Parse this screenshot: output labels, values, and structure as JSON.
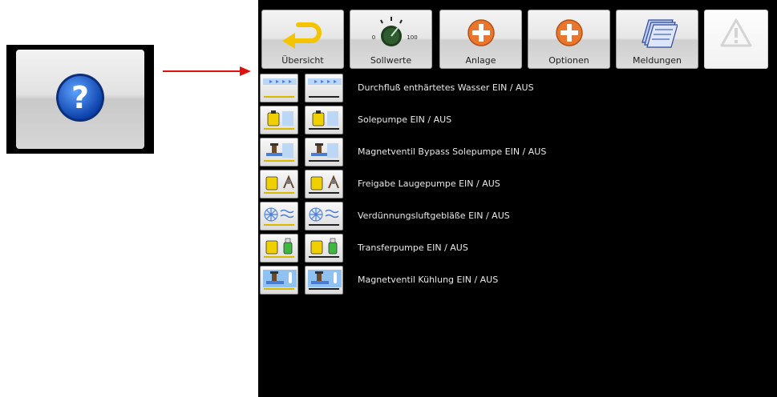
{
  "toolbar": {
    "buttons": [
      {
        "label": "Übersicht",
        "icon": "back-arrow-icon"
      },
      {
        "label": "Sollwerte",
        "icon": "dial-icon",
        "dial_min": "0",
        "dial_max": "100"
      },
      {
        "label": "Anlage",
        "icon": "plus-icon"
      },
      {
        "label": "Optionen",
        "icon": "plus-icon"
      },
      {
        "label": "Meldungen",
        "icon": "messages-icon"
      },
      {
        "label": "",
        "icon": "warning-icon"
      }
    ]
  },
  "help": {
    "icon": "help-question-icon"
  },
  "rows": [
    {
      "text": "Durchfluß enthärtetes Wasser EIN / AUS",
      "icon": "flow-icon"
    },
    {
      "text": "Solepumpe EIN / AUS",
      "icon": "pump-icon"
    },
    {
      "text": "Magnetventil Bypass Solepumpe EIN / AUS",
      "icon": "valve-icon"
    },
    {
      "text": "Freigabe Laugepumpe EIN / AUS",
      "icon": "lye-pump-icon"
    },
    {
      "text": "Verdünnungsluftgebläße EIN / AUS",
      "icon": "fan-icon"
    },
    {
      "text": "Transferpumpe EIN / AUS",
      "icon": "transfer-pump-icon"
    },
    {
      "text": "Magnetventil Kühlung EIN / AUS",
      "icon": "cooling-valve-icon"
    }
  ],
  "colors": {
    "accent_arrow": "#e01010",
    "screen_bg": "#000000",
    "row_text": "#e8e8e8",
    "active_bar": "#d6b800"
  }
}
